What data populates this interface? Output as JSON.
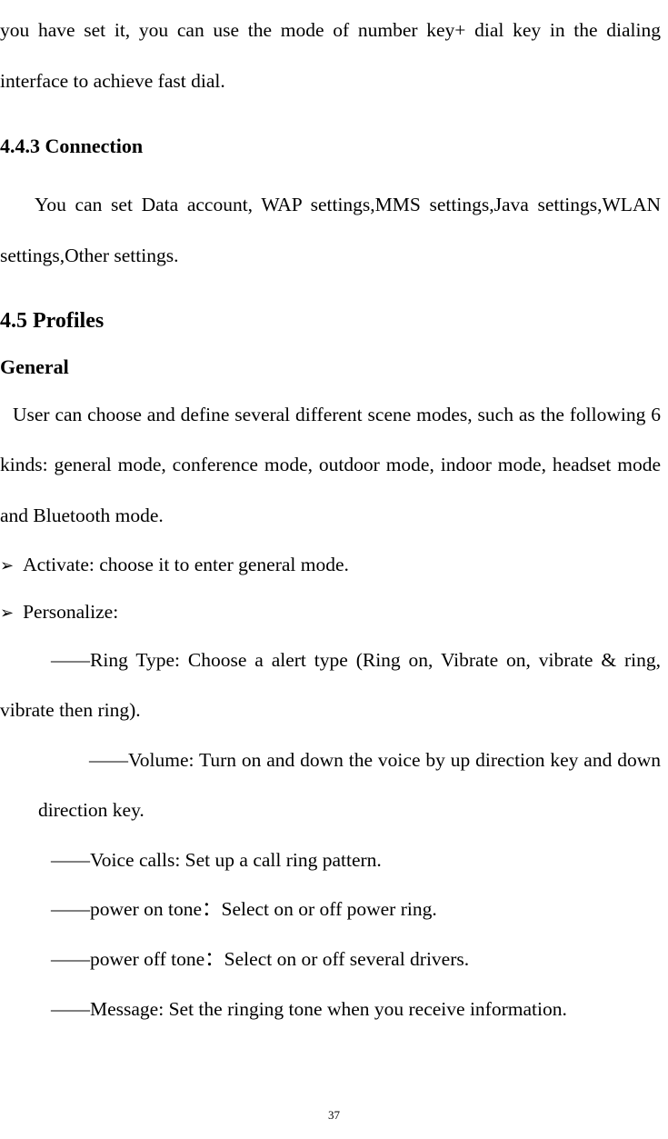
{
  "intro": "you have set it, you can use the mode of number key+ dial key in the dialing interface to achieve fast dial.",
  "section443": {
    "heading": "4.4.3 Connection",
    "body": "You can set Data account, WAP settings,MMS settings,Java settings,WLAN settings,Other settings."
  },
  "section45": {
    "heading": "4.5 Profiles",
    "general": {
      "heading": "General",
      "body": "User can choose and define several different scene modes, such as the following 6 kinds: general mode, conference mode, outdoor mode, indoor mode, headset mode and Bluetooth mode."
    },
    "bullets": {
      "activate": "Activate: choose it to enter general mode.",
      "personalize": "Personalize:"
    },
    "subitems": {
      "ringType": "——Ring Type: Choose a alert type (Ring on, Vibrate on, vibrate & ring, vibrate then ring).",
      "volume": "——Volume: Turn on and down the voice by up direction key and down direction key.",
      "voiceCalls": "——Voice calls: Set up a call ring pattern.",
      "powerOn": "——power on tone：Select on or off power ring.",
      "powerOff": "——power off tone：Select on or off several drivers.",
      "message": "——Message: Set the ringing tone when you receive information."
    }
  },
  "pageNumber": "37"
}
